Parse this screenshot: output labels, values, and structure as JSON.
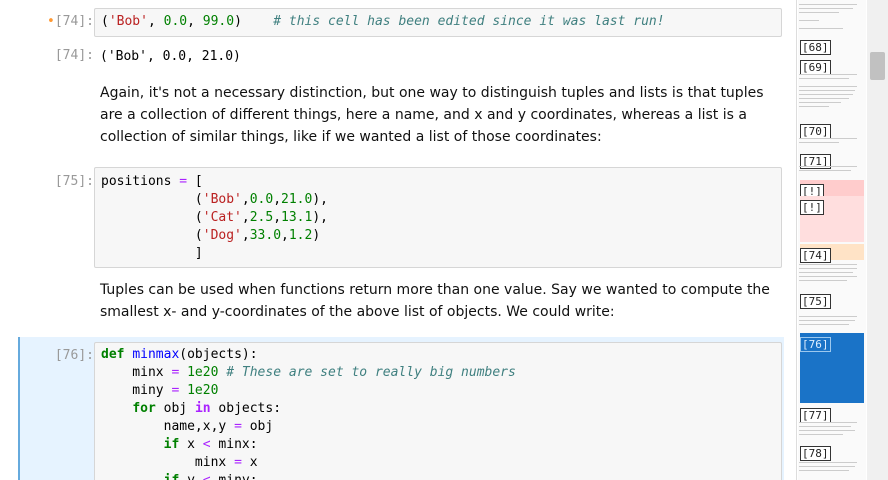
{
  "cells": {
    "c74_in": {
      "prompt_mark": "•",
      "prompt": "[74]:"
    },
    "c74_out": {
      "prompt": "[74]:",
      "text": "('Bob', 0.0, 21.0)"
    },
    "md1": {
      "text": "Again, it's not a necessary distinction, but one way to distinguish tuples and lists is that tuples are a collection of different things, here a name, and x and y coordinates, whereas a list is a collection of similar things, like if we wanted a list of those coordinates:"
    },
    "c75": {
      "prompt": "[75]:"
    },
    "md2": {
      "text": "Tuples can be used when functions return more than one value. Say we wanted to compute the smallest x- and y-coordinates of the above list of objects. We could write:"
    },
    "c76": {
      "prompt": "[76]:"
    }
  },
  "minimap": {
    "labels": [
      "[68]",
      "[69]",
      "[70]",
      "[71]",
      "[!]",
      "[!]",
      "[74]",
      "[75]",
      "[76]",
      "[77]",
      "[78]"
    ]
  },
  "colors": {
    "selected_cell": "#e6f3ff",
    "keyword": "#008000",
    "string": "#ba2121",
    "comment": "#408080",
    "operator": "#aa22ff",
    "error_mini": "#ffcccc",
    "active_mini": "#1a73c7"
  }
}
